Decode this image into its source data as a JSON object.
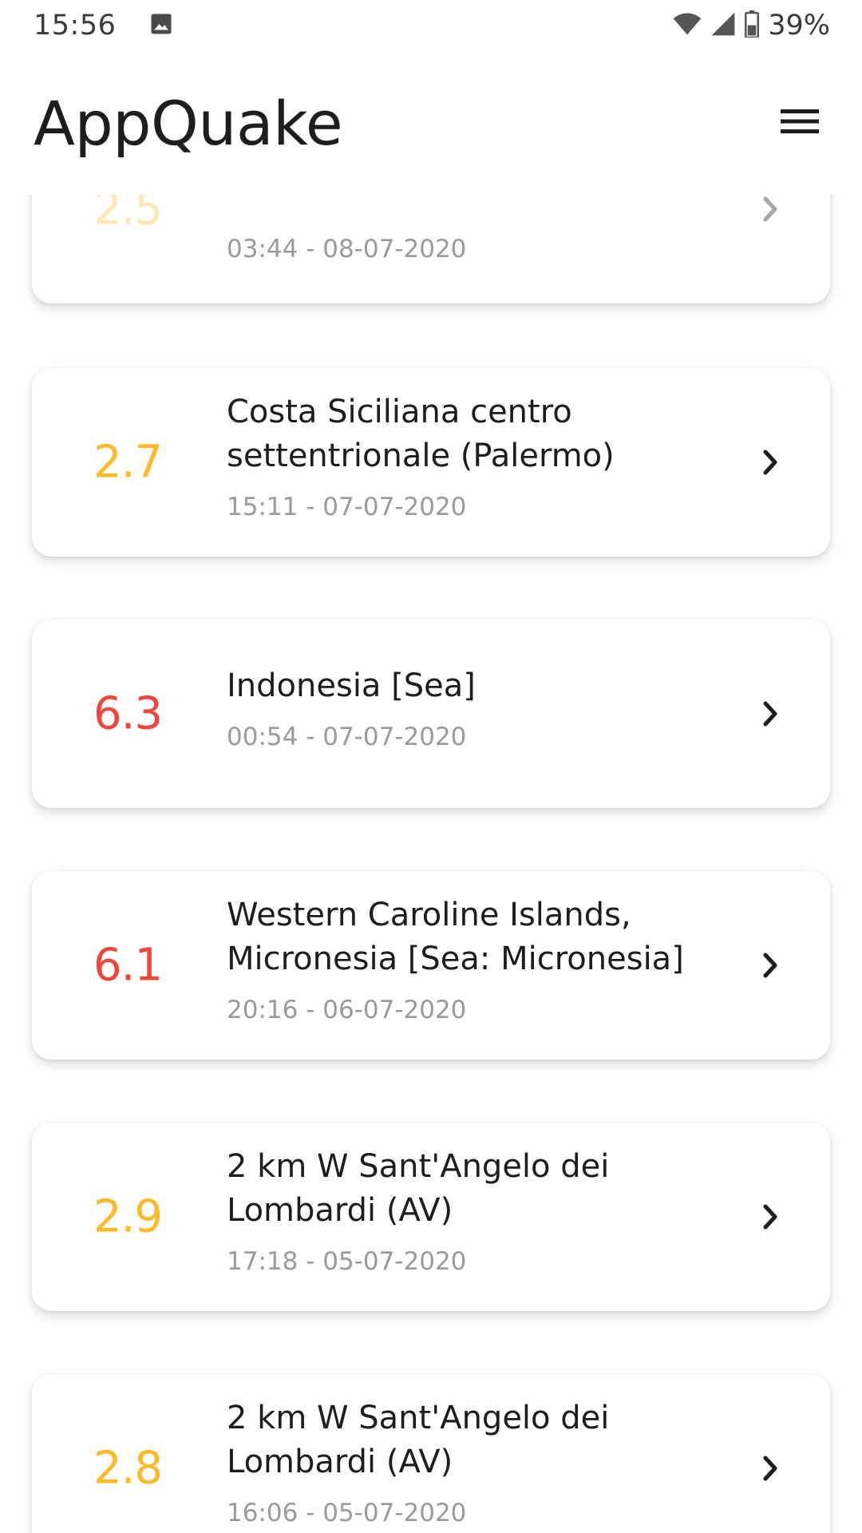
{
  "status_bar": {
    "time": "15:56",
    "battery": "39%",
    "icons": [
      "image-icon",
      "wifi-icon",
      "signal-icon",
      "battery-icon"
    ]
  },
  "app_bar": {
    "title": "AppQuake",
    "menu_icon": "hamburger-menu-icon"
  },
  "colors": {
    "low": "#FFB925",
    "high": "#F0453A",
    "text": "#1D1D1D",
    "subtext": "#9A9A9A"
  },
  "earthquakes": [
    {
      "magnitude": "2.5",
      "place": "",
      "datetime": "03:44 - 08-07-2020",
      "severity": "low"
    },
    {
      "magnitude": "2.7",
      "place": "Costa Siciliana centro settentrionale (Palermo)",
      "datetime": "15:11 - 07-07-2020",
      "severity": "low"
    },
    {
      "magnitude": "6.3",
      "place": "Indonesia [Sea]",
      "datetime": "00:54 - 07-07-2020",
      "severity": "high"
    },
    {
      "magnitude": "6.1",
      "place": "Western Caroline Islands, Micronesia [Sea: Micronesia]",
      "datetime": "20:16 - 06-07-2020",
      "severity": "high"
    },
    {
      "magnitude": "2.9",
      "place": "2 km W Sant'Angelo dei Lombardi (AV)",
      "datetime": "17:18 - 05-07-2020",
      "severity": "low"
    },
    {
      "magnitude": "2.8",
      "place": "2 km W Sant'Angelo dei Lombardi (AV)",
      "datetime": "16:06 - 05-07-2020",
      "severity": "low"
    }
  ]
}
